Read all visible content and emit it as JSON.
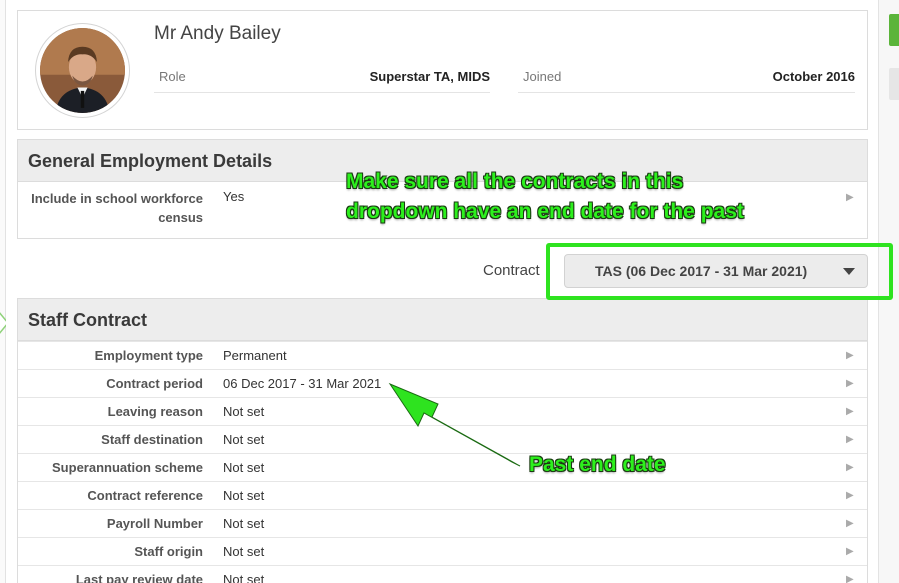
{
  "profile": {
    "name": "Mr Andy Bailey",
    "role_label": "Role",
    "role_value": "Superstar TA, MIDS",
    "joined_label": "Joined",
    "joined_value": "October 2016"
  },
  "general": {
    "title": "General Employment Details",
    "rows": [
      {
        "label": "Include in school workforce census",
        "value": "Yes"
      }
    ]
  },
  "contract_selector": {
    "label": "Contract",
    "selected": "TAS (06 Dec 2017 - 31 Mar 2021)"
  },
  "staff_contract": {
    "title": "Staff Contract",
    "rows": [
      {
        "label": "Employment type",
        "value": "Permanent"
      },
      {
        "label": "Contract period",
        "value": "06 Dec 2017 - 31 Mar 2021"
      },
      {
        "label": "Leaving reason",
        "value": "Not set"
      },
      {
        "label": "Staff destination",
        "value": "Not set"
      },
      {
        "label": "Superannuation scheme",
        "value": "Not set"
      },
      {
        "label": "Contract reference",
        "value": "Not set"
      },
      {
        "label": "Payroll Number",
        "value": "Not set"
      },
      {
        "label": "Staff origin",
        "value": "Not set"
      },
      {
        "label": "Last pay review date",
        "value": "Not set"
      }
    ]
  },
  "annotations": {
    "top_line1": "Make sure all the contracts in this",
    "top_line2": "dropdown have an end date for the past",
    "bottom": "Past end date",
    "color": "#2ee31f"
  },
  "colors": {
    "accent_green": "#5bb43a",
    "header_bg": "#ededed"
  }
}
